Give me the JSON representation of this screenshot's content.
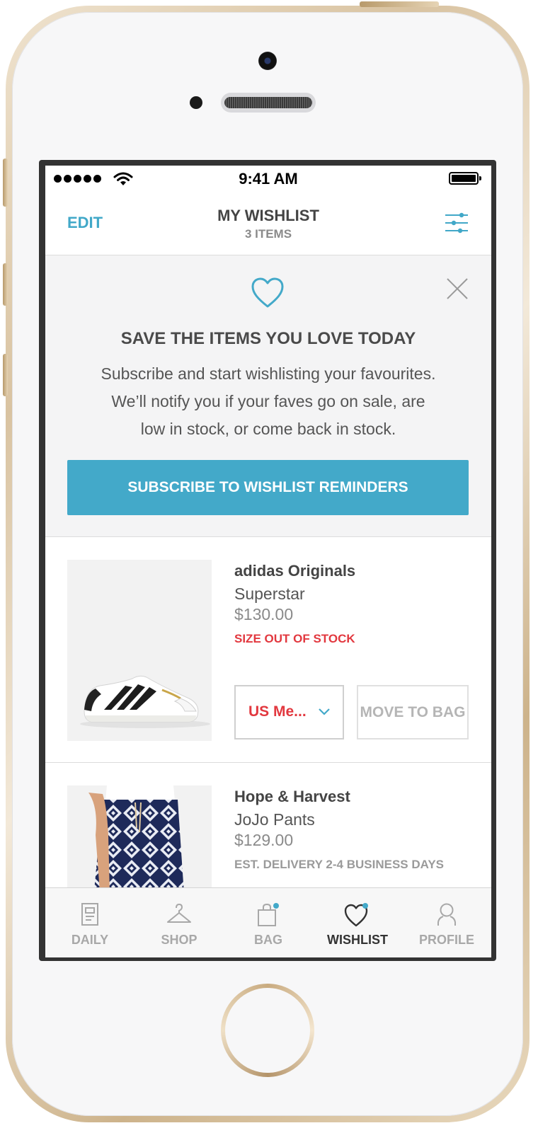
{
  "status_bar": {
    "time": "9:41 AM"
  },
  "nav": {
    "edit_label": "EDIT",
    "title": "MY WISHLIST",
    "subtitle": "3 ITEMS"
  },
  "promo": {
    "title": "SAVE THE ITEMS YOU LOVE TODAY",
    "body_lines": [
      "Subscribe and start wishlisting your favourites.",
      "We’ll notify you if your faves go on sale, are",
      "low in stock, or come back in stock."
    ],
    "button_label": "SUBSCRIBE TO WISHLIST REMINDERS"
  },
  "products": [
    {
      "brand": "adidas Originals",
      "name": "Superstar",
      "price": "$130.00",
      "status": "SIZE OUT OF STOCK",
      "size_value": "US Me...",
      "move_label": "MOVE TO BAG"
    },
    {
      "brand": "Hope & Harvest",
      "name": "JoJo Pants",
      "price": "$129.00",
      "status": "EST. DELIVERY 2-4 BUSINESS DAYS"
    }
  ],
  "tabs": [
    {
      "label": "DAILY",
      "icon": "newspaper-icon",
      "active": false
    },
    {
      "label": "SHOP",
      "icon": "hanger-icon",
      "active": false
    },
    {
      "label": "BAG",
      "icon": "shopping-bag-icon",
      "active": false
    },
    {
      "label": "WISHLIST",
      "icon": "heart-icon",
      "active": true
    },
    {
      "label": "PROFILE",
      "icon": "user-icon",
      "active": false
    }
  ],
  "colors": {
    "accent": "#43a9c9",
    "alert": "#e2383f",
    "text_dark": "#444444",
    "muted": "#a8a8a8"
  }
}
